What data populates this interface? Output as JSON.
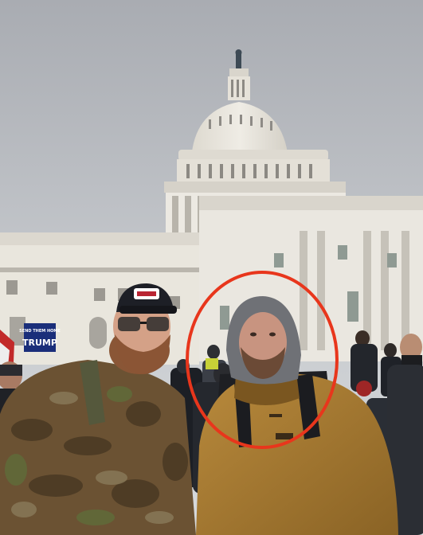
{
  "photo": {
    "sign_small_text": "SEND THEM HOME",
    "sign_large_text": "TRUMP",
    "highlight_color": "#e8361c",
    "sky_color": "#b9bcc1",
    "building_color": "#e9e6dd"
  }
}
